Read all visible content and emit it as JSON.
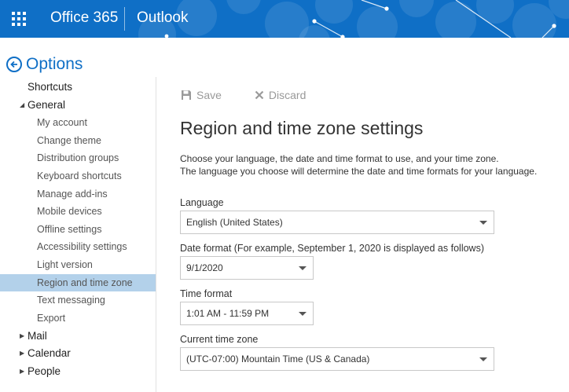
{
  "header": {
    "brand": "Office 365",
    "app": "Outlook",
    "colors": {
      "bar": "#0f6fc6"
    }
  },
  "options": {
    "title": "Options"
  },
  "nav": {
    "shortcuts": "Shortcuts",
    "general": "General",
    "general_items": [
      "My account",
      "Change theme",
      "Distribution groups",
      "Keyboard shortcuts",
      "Manage add-ins",
      "Mobile devices",
      "Offline settings",
      "Accessibility settings",
      "Light version",
      "Region and time zone",
      "Text messaging",
      "Export"
    ],
    "mail": "Mail",
    "calendar": "Calendar",
    "people": "People",
    "selected": "Region and time zone"
  },
  "toolbar": {
    "save_label": "Save",
    "discard_label": "Discard"
  },
  "main": {
    "title": "Region and time zone settings",
    "desc_line1": "Choose your language, the date and time format to use, and your time zone.",
    "desc_line2": "The language you choose will determine the date and time formats for your language.",
    "language": {
      "label": "Language",
      "value": "English (United States)"
    },
    "date_format": {
      "label": "Date format (For example, September 1, 2020 is displayed as follows)",
      "value": "9/1/2020"
    },
    "time_format": {
      "label": "Time format",
      "value": "1:01 AM - 11:59 PM"
    },
    "time_zone": {
      "label": "Current time zone",
      "value": "(UTC-07:00) Mountain Time (US & Canada)"
    }
  }
}
